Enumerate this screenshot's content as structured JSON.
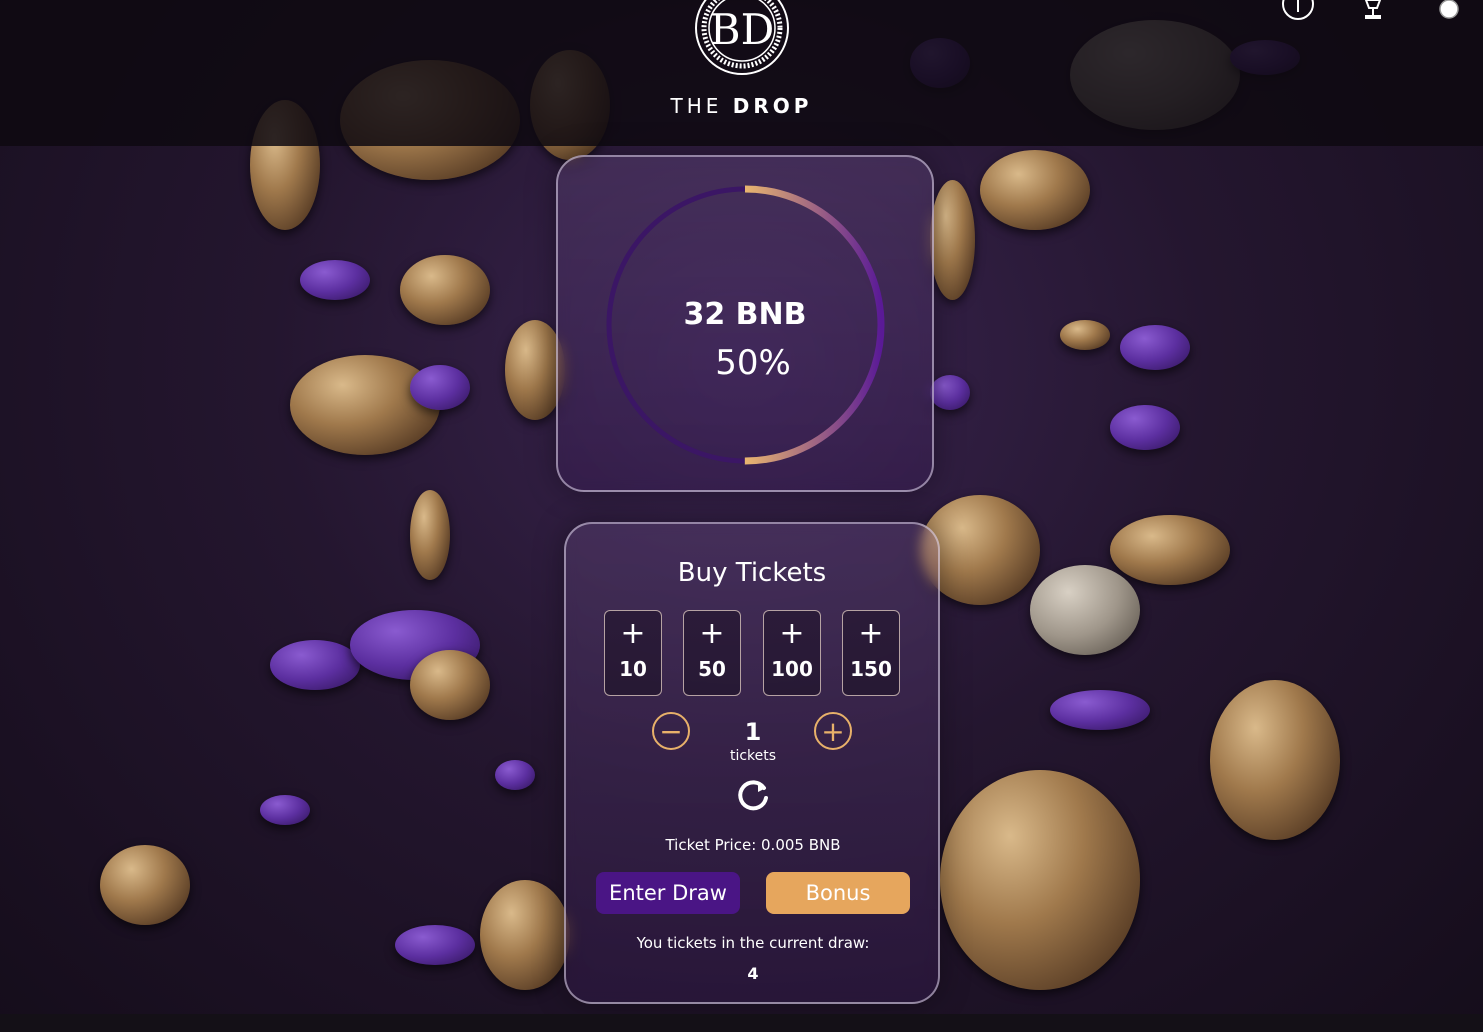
{
  "header": {
    "logo_initials": "BD",
    "brand_name_light": "THE",
    "brand_name_bold": "DROP",
    "icons": [
      "info-icon",
      "trophy-icon",
      "toggle-icon"
    ]
  },
  "jackpot": {
    "amount": "32 BNB",
    "progress_label": "50%",
    "progress": 0.5
  },
  "buy_tickets": {
    "title": "Buy Tickets",
    "quick_add": [
      "10",
      "50",
      "100",
      "150"
    ],
    "plus_symbol": "+",
    "decrement_symbol": "−",
    "increment_symbol": "+",
    "count": "1",
    "count_label": "tickets",
    "ticket_price": "Ticket Price: 0.005 BNB",
    "enter_label": "Enter Draw",
    "bonus_label": "Bonus",
    "your_tickets_label": "You tickets in the current draw:",
    "your_tickets_count": "4"
  },
  "colors": {
    "accent_gold": "#e6a65d",
    "accent_purple": "#4a1585"
  }
}
